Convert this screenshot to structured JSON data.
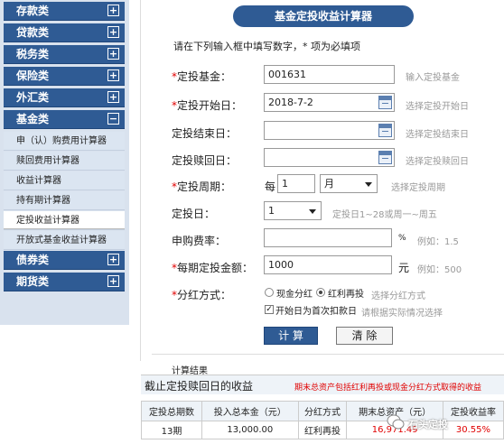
{
  "sidebar": {
    "categories": [
      {
        "label": "存款类",
        "toggle": "+"
      },
      {
        "label": "贷款类",
        "toggle": "+"
      },
      {
        "label": "税务类",
        "toggle": "+"
      },
      {
        "label": "保险类",
        "toggle": "+"
      },
      {
        "label": "外汇类",
        "toggle": "+"
      },
      {
        "label": "基金类",
        "toggle": "−"
      },
      {
        "label": "债券类",
        "toggle": "+"
      },
      {
        "label": "期货类",
        "toggle": "+"
      }
    ],
    "fund_items": [
      {
        "label": "申（认）购费用计算器"
      },
      {
        "label": "赎回费用计算器"
      },
      {
        "label": "收益计算器"
      },
      {
        "label": "持有期计算器"
      },
      {
        "label": "定投收益计算器",
        "active": true
      },
      {
        "label": "开放式基金收益计算器"
      }
    ]
  },
  "main": {
    "title": "基金定投收益计算器",
    "intro": "请在下列输入框中填写数字，* 项为必填项",
    "star": "*",
    "fund": {
      "label": "定投基金：",
      "value": "001631",
      "hint": "输入定投基金"
    },
    "start_date": {
      "label": "定投开始日：",
      "value": "2018-7-2",
      "hint": "选择定投开始日"
    },
    "end_date": {
      "label": "定投结束日：",
      "value": "",
      "hint": "选择定投结束日"
    },
    "redeem_date": {
      "label": "定投赎回日：",
      "value": "",
      "hint": "选择定投赎回日"
    },
    "period": {
      "label": "定投周期：",
      "prefix": "每",
      "value": "1",
      "unit": "月",
      "hint": "选择定投周期"
    },
    "day": {
      "label": "定投日：",
      "value": "1",
      "hint": "定投日1~28或周一~周五"
    },
    "fee": {
      "label": "申购费率：",
      "value": "",
      "unit": "%",
      "hint": "例如：1.5"
    },
    "amount": {
      "label": "每期定投金额：",
      "value": "1000",
      "unit": "元",
      "hint": "例如：500"
    },
    "dividend": {
      "label": "分红方式：",
      "option_cash": "现金分红",
      "option_reinvest": "红利再投",
      "hint": "选择分红方式"
    },
    "first_day": {
      "label": "开始日为首次扣款日",
      "hint": "请根据实际情况选择"
    },
    "calc_button": "计 算",
    "clear_button": "清 除"
  },
  "result": {
    "section_title": "计算结果",
    "heading": "截止定投赎回日的收益",
    "note": "期末总资产包括红利再投或现金分红方式取得的收益",
    "columns": [
      "定投总期数",
      "投入总本金（元）",
      "分红方式",
      "期末总资产（元）",
      "定投收益率"
    ],
    "rows": [
      [
        "13期",
        "13,000.00",
        "红利再投",
        "16,971.49",
        "30.55%"
      ]
    ]
  },
  "watermark": "石头定投",
  "colors": {
    "brand": "#2f5b94",
    "required": "#e00000",
    "hint": "#999999"
  }
}
